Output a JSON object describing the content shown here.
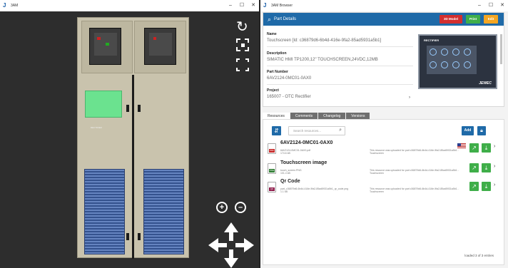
{
  "left_window": {
    "title": "3AM",
    "controls": [
      "–",
      "☐",
      "✕"
    ],
    "cabinet_label": "RECTIFIER"
  },
  "right_window": {
    "title": "3AM Browser",
    "controls": [
      "–",
      "☐",
      "✕"
    ],
    "part_details": {
      "header": "Part Details",
      "buttons": {
        "model": "3D Model",
        "print": "Print",
        "edit": "Edit"
      },
      "name_label": "Name",
      "name_value": "Touchscreen [Id: c36879d6-6b4d-416e-9fa2-85ad5931a5b1]",
      "description_label": "Description",
      "description_value": "SIMATIC HMI TP1200,12\" TOUCHSCREEN,24VDC,12MB",
      "part_number_label": "Part Number",
      "part_number_value": "6AV2124-0MC01-0AX0",
      "project_label": "Project",
      "project_value": "165007 - OTC Rectifier",
      "image_title": "RECTIFIER",
      "image_brand": "JEWEC"
    },
    "tabs": [
      "Resources",
      "Comments",
      "Changelog",
      "Versions"
    ],
    "resources": {
      "search_placeholder": "Search resources...",
      "add_label": "Add",
      "items": [
        {
          "title": "6AV2124-0MC01-0AX0",
          "file": "6AV2124-0MC01-0AX0.pdf",
          "size": "174.6 kB",
          "type": "PDF",
          "type_color": "#c62828",
          "note": "This resource was uploaded for part c36879d6-6b4d-416e-9fa2-85ad5931a5b1 - Touchscreen"
        },
        {
          "title": "Touchscreen image",
          "file": "touch_screen.PNG",
          "size": "101.4 kB",
          "type": "PNG",
          "type_color": "#2e7d32",
          "note": "This resource was uploaded for part c36879d6-6b4d-416e-9fa2-85ad5931a5b1 - Touchscreen"
        },
        {
          "title": "Qr Code",
          "file": "part_c36879d6-6b4d-416e-9fa2-85ad5931a5b1_qr_code.png",
          "size": "1.1 kB",
          "type": "QR",
          "type_color": "#8e1b4a",
          "note": "This resource was uploaded for part c36879d6-6b4d-416e-9fa2-85ad5931a5b1 - Touchscreen"
        }
      ],
      "loaded_text": "loaded 3 of 3 entries"
    }
  },
  "colors": {
    "accent": "#1f6aa8",
    "success": "#3fae49",
    "danger": "#d32f2f",
    "warning": "#f5a623",
    "highlight": "#6be28f"
  }
}
